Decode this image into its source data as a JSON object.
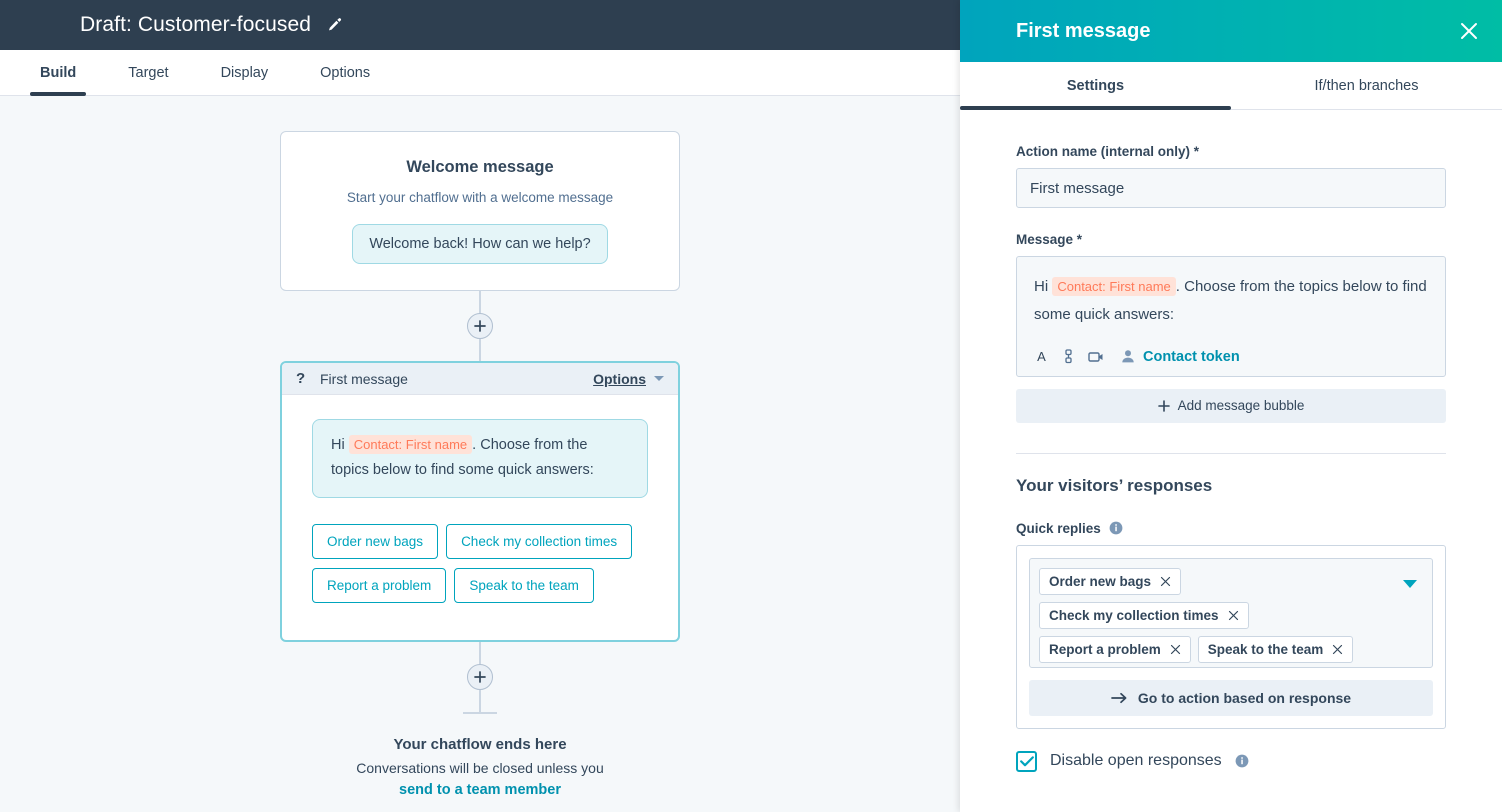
{
  "topbar": {
    "title": "Draft: Customer-focused",
    "edit_icon": "pencil-icon"
  },
  "tabs": [
    {
      "label": "Build",
      "active": true
    },
    {
      "label": "Target",
      "active": false
    },
    {
      "label": "Display",
      "active": false
    },
    {
      "label": "Options",
      "active": false
    }
  ],
  "canvas": {
    "welcome_card": {
      "title": "Welcome message",
      "subtitle": "Start your chatflow with a welcome message",
      "bubble_text": "Welcome back! How can we help?"
    },
    "message_card": {
      "badge_icon": "question-mark-icon",
      "title": "First message",
      "options_label": "Options",
      "bubble_prefix": "Hi",
      "bubble_token": "Contact: First name",
      "bubble_suffix": ". Choose from the topics below to find some quick answers:",
      "quick_replies": [
        "Order new bags",
        "Check my collection times",
        "Report a problem",
        "Speak to the team"
      ]
    },
    "flow_end": {
      "title": "Your chatflow ends here",
      "subtitle": "Conversations will be closed unless you",
      "link": "send to a team member"
    }
  },
  "panel": {
    "title": "First message",
    "close_icon": "close-icon",
    "tabs": [
      {
        "label": "Settings",
        "active": true
      },
      {
        "label": "If/then branches",
        "active": false
      }
    ],
    "action_name": {
      "label": "Action name (internal only) *",
      "value": "First message",
      "placeholder": "Action name"
    },
    "message": {
      "label": "Message *",
      "prefix": "Hi",
      "token": "Contact: First name",
      "suffix": ". Choose from the topics below to find some quick answers:",
      "toolbar": [
        {
          "name": "text-format-icon",
          "glyph": "A"
        },
        {
          "name": "link-icon",
          "glyph": "link"
        },
        {
          "name": "media-icon",
          "glyph": "media"
        },
        {
          "name": "contact-person-icon",
          "glyph": "person"
        }
      ],
      "contact_token_label": "Contact token",
      "add_bubble_label": "Add message bubble"
    },
    "responses": {
      "section_title": "Your visitors’ responses",
      "quick_replies_label": "Quick replies",
      "quick_replies_info_icon": "info-icon",
      "chips": [
        "Order new bags",
        "Check my collection times",
        "Report a problem",
        "Speak to the team"
      ],
      "goto_label": "Go to action based on response",
      "disable_open_responses_label": "Disable open responses",
      "disable_open_responses_checked": true,
      "disable_info_icon": "info-icon"
    }
  },
  "colors": {
    "header_gradient_start": "#00A4BD",
    "header_gradient_end": "#00BDA5",
    "topbar_bg": "#2E3F50",
    "accent_teal": "#00A4BD",
    "link_teal": "#0091AE",
    "token_bg": "#FFE2D8",
    "token_text": "#FF7A59",
    "canvas_bg": "#F5F8FA",
    "text_primary": "#33475B"
  }
}
